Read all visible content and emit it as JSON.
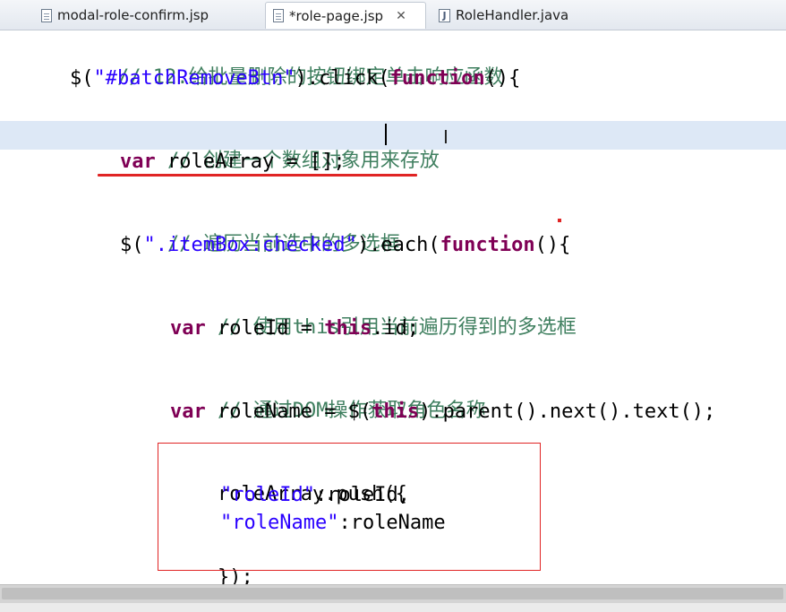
{
  "tabs": [
    {
      "label": "modal-role-confirm.jsp",
      "active": false
    },
    {
      "label": "*role-page.jsp",
      "active": true
    },
    {
      "label": "RoleHandler.java",
      "active": false
    }
  ],
  "code": {
    "l1_comment": "// 12.给批量删除的按钮绑定单击响应函数",
    "l2_a": "$(",
    "l2_str": "\"#batchRemoveBtn\"",
    "l2_b": ").click(",
    "l2_kw": "function",
    "l2_c": "(){",
    "l3_comment": "// 创建一个数组对象用来存放",
    "l4_kw": "var",
    "l4_rest": " roleArray = [];",
    "l5_comment": "// 遍历当前选中的多选框",
    "l6_a": "$(",
    "l6_str": "\".itemBox:checked\"",
    "l6_b": ").each(",
    "l6_kw": "function",
    "l6_c": "(){",
    "l7_comment": "// 使用this引用当前遍历得到的多选框",
    "l8_kw": "var",
    "l8_a": " roleId = ",
    "l8_kw2": "this",
    "l8_b": ".id;",
    "l9_comment": "// 通过DOM操作获取角色名称",
    "l10_kw": "var",
    "l10_a": " roleName = $(",
    "l10_kw2": "this",
    "l10_b": ").parent().next().text();",
    "l11": "roleArray.push({",
    "l12_str": "\"roleId\"",
    "l12_rest": ":roleId,",
    "l13_str": "\"roleName\"",
    "l13_rest": ":roleName",
    "l14": "});",
    "l15": "});"
  },
  "colors": {
    "comment": "#3f7f5f",
    "keyword": "#7f0055",
    "string": "#2a00ff",
    "annotation": "#e02424",
    "current_line": "#dde8f6"
  }
}
